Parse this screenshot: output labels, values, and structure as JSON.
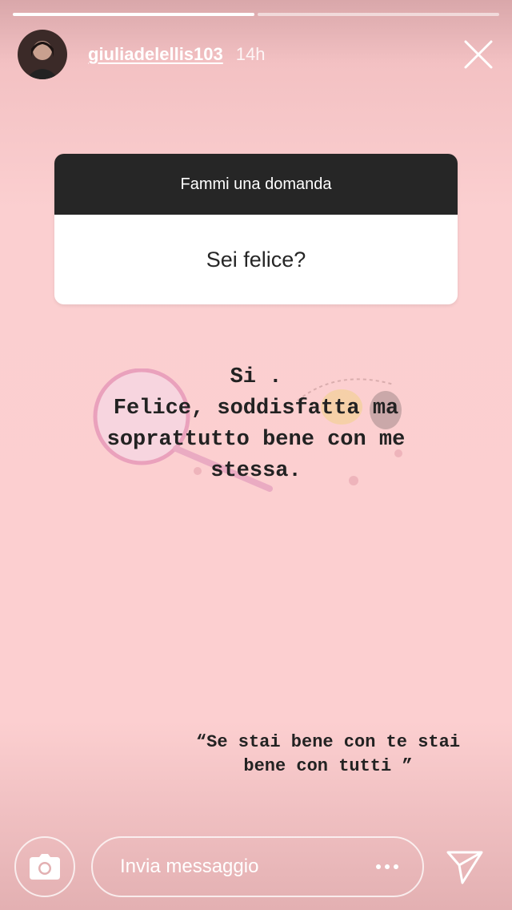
{
  "story": {
    "progress": {
      "total_segments": 2,
      "completed_segments": 1
    },
    "username": "giuliadelellis103",
    "time_ago": "14h"
  },
  "question_sticker": {
    "header": "Fammi una domanda",
    "question": "Sei felice?"
  },
  "answer_lines": [
    "Si .",
    "Felice, soddisfatta ma",
    "soprattutto bene con me",
    "stessa."
  ],
  "quote_lines": [
    "“Se stai bene con te stai",
    "bene con tutti ”"
  ],
  "footer": {
    "message_placeholder": "Invia messaggio"
  },
  "icons": {
    "close": "close-icon",
    "camera": "camera-icon",
    "more": "more-dots-icon",
    "send": "send-icon"
  },
  "colors": {
    "background": "#fccfd0",
    "sticker_header": "#262626",
    "text": "#222222"
  }
}
